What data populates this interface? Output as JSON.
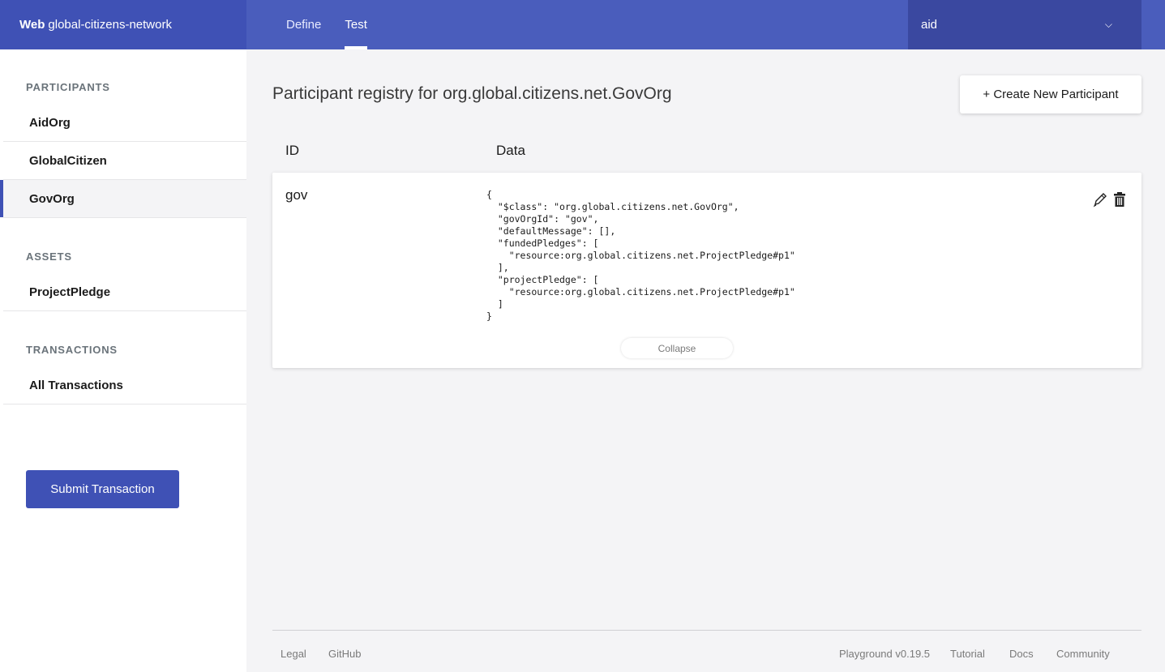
{
  "header": {
    "brand_bold": "Web",
    "brand_name": "global-citizens-network",
    "tabs": [
      {
        "label": "Define",
        "active": false
      },
      {
        "label": "Test",
        "active": true
      }
    ],
    "identity": "aid"
  },
  "sidebar": {
    "participants_title": "PARTICIPANTS",
    "participants": [
      "AidOrg",
      "GlobalCitizen",
      "GovOrg"
    ],
    "active_participant": "GovOrg",
    "assets_title": "ASSETS",
    "assets": [
      "ProjectPledge"
    ],
    "transactions_title": "TRANSACTIONS",
    "transactions": [
      "All Transactions"
    ],
    "submit_label": "Submit Transaction"
  },
  "main": {
    "title": "Participant registry for org.global.citizens.net.GovOrg",
    "create_label": "+ Create New Participant",
    "col_id": "ID",
    "col_data": "Data",
    "records": [
      {
        "id": "gov",
        "data": "{\n  \"$class\": \"org.global.citizens.net.GovOrg\",\n  \"govOrgId\": \"gov\",\n  \"defaultMessage\": [],\n  \"fundedPledges\": [\n    \"resource:org.global.citizens.net.ProjectPledge#p1\"\n  ],\n  \"projectPledge\": [\n    \"resource:org.global.citizens.net.ProjectPledge#p1\"\n  ]\n}",
        "collapse_label": "Collapse"
      }
    ]
  },
  "footer": {
    "legal": "Legal",
    "github": "GitHub",
    "version": "Playground v0.19.5",
    "tutorial": "Tutorial",
    "docs": "Docs",
    "community": "Community"
  },
  "colors": {
    "topbar": "#4a5dbc",
    "brand_bg": "#3f51b5",
    "identity_bg": "#3a48a0",
    "accent": "#3f51b5"
  },
  "icons": [
    "chevron-down-icon",
    "pencil-icon",
    "trash-icon"
  ]
}
